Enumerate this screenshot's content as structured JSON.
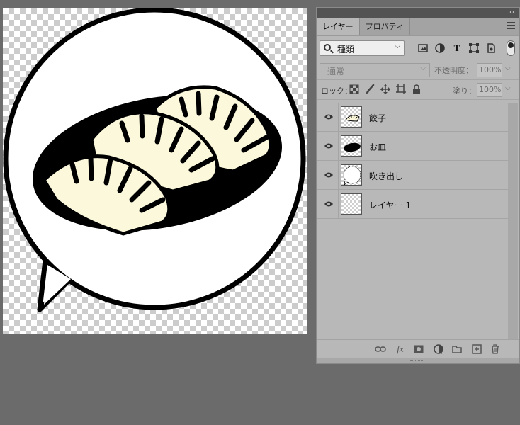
{
  "canvas": {
    "art_description_icons": [
      "speech-bubble",
      "plate",
      "gyoza"
    ],
    "colors": {
      "outline": "#000000",
      "gyoza_fill": "#fbf8dc",
      "bubble_fill": "#ffffff"
    }
  },
  "panel": {
    "collapse_glyph": "‹‹",
    "tabs": [
      {
        "label": "レイヤー",
        "active": true
      },
      {
        "label": "プロパティ",
        "active": false
      }
    ],
    "filter": {
      "label": "種類"
    },
    "blend_mode": "通常",
    "opacity_label": "不透明度：",
    "opacity_value": "100%",
    "lock_label": "ロック：",
    "fill_label": "塗り：",
    "fill_value": "100%",
    "layers": [
      {
        "name": "餃子",
        "visible": true,
        "thumb": "gyoza"
      },
      {
        "name": "お皿",
        "visible": true,
        "thumb": "plate"
      },
      {
        "name": "吹き出し",
        "visible": true,
        "thumb": "bubble"
      },
      {
        "name": "レイヤー 1",
        "visible": true,
        "thumb": "empty"
      }
    ],
    "fx_label": "fx"
  }
}
